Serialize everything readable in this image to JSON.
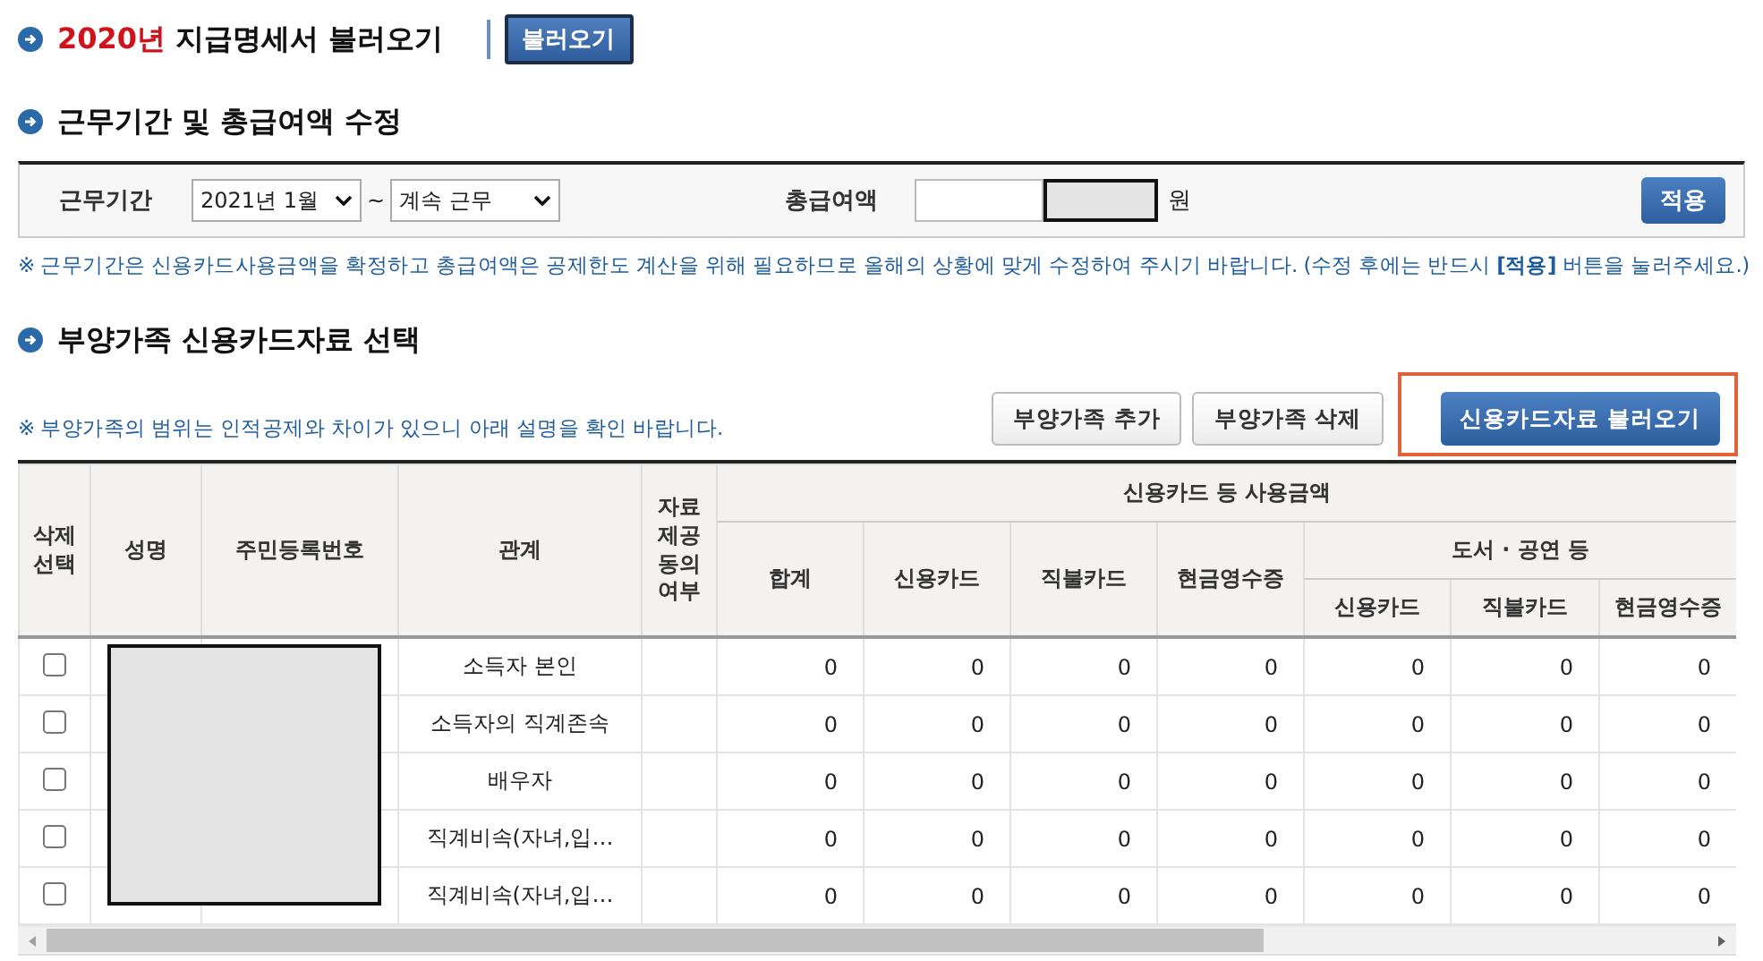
{
  "load_section": {
    "year": "2020년",
    "title": "지급명세서 불러오기",
    "button": "불러오기"
  },
  "period_section": {
    "title": "근무기간 및 총급여액 수정",
    "period_label": "근무기간",
    "start": "2021년 1월",
    "separator": "~",
    "end": "계속 근무",
    "salary_label": "총급여액",
    "salary_unit": "원",
    "apply_button": "적용",
    "note": "※ 근무기간은 신용카드사용금액을 확정하고 총급여액은 공제한도 계산을 위해 필요하므로 올해의 상황에 맞게 수정하여 주시기 바랍니다. (수정 후에는 반드시 **[적용]** 버튼을 눌러주세요.)"
  },
  "dependents_section": {
    "title": "부양가족 신용카드자료 선택",
    "note": "※ 부양가족의 범위는 인적공제와 차이가 있으니 아래 설명을 확인 바랍니다.",
    "buttons": [
      {
        "label": "부양가족 추가",
        "kind": "secondary",
        "highlighted": false
      },
      {
        "label": "부양가족 삭제",
        "kind": "secondary",
        "highlighted": false
      },
      {
        "label": "신용카드자료 불러오기",
        "kind": "primary",
        "highlighted": true
      }
    ],
    "table": {
      "fixed_columns": [
        "삭제선택",
        "성명",
        "주민등록번호",
        "관계",
        "자료제공동의여부"
      ],
      "group_header": "신용카드 등 사용금액",
      "amount_columns": [
        "합계",
        "신용카드",
        "직불카드",
        "현금영수증"
      ],
      "sub_group_header": "도서 · 공연 등",
      "sub_columns": [
        "신용카드",
        "직불카드",
        "현금영수증"
      ],
      "rows": [
        {
          "checked": false,
          "relation": "소득자 본인",
          "values": [
            "0",
            "0",
            "0",
            "0",
            "0",
            "0",
            "0"
          ]
        },
        {
          "checked": false,
          "relation": "소득자의 직계존속",
          "values": [
            "0",
            "0",
            "0",
            "0",
            "0",
            "0",
            "0"
          ]
        },
        {
          "checked": false,
          "relation": "배우자",
          "values": [
            "0",
            "0",
            "0",
            "0",
            "0",
            "0",
            "0"
          ]
        },
        {
          "checked": false,
          "relation": "직계비속(자녀,입…",
          "values": [
            "0",
            "0",
            "0",
            "0",
            "0",
            "0",
            "0"
          ]
        },
        {
          "checked": false,
          "relation": "직계비속(자녀,입…",
          "values": [
            "0",
            "0",
            "0",
            "0",
            "0",
            "0",
            "0"
          ]
        }
      ]
    }
  }
}
